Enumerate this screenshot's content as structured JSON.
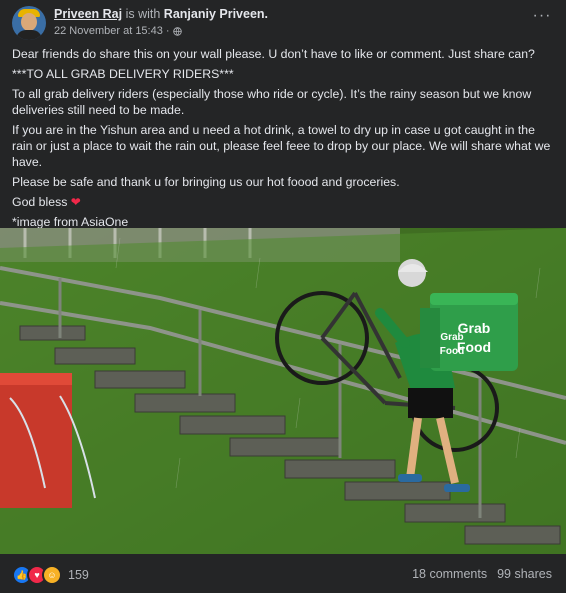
{
  "author": {
    "name": "Priveen Raj",
    "with_text": "is with",
    "tagged": "Ranjaniy Priveen."
  },
  "timestamp": "22 November at 15:43 ·",
  "privacy_icon": "globe-icon",
  "more_icon": "more-options-icon",
  "post_text": {
    "p1": "Dear friends do share this on your wall please. U don’t have to like or comment.  Just share can?",
    "p2": "***TO ALL GRAB DELIVERY RIDERS***",
    "p3": "To all grab delivery riders (especially those who ride or cycle). It’s the rainy season but we know deliveries still need to be made.",
    "p4": "If you are in the Yishun area and u need a hot drink, a towel to dry up in case u got caught in the rain or just a place to wait the rain out, please feel feee to drop by our place.  We will share what we have.",
    "p5": "Please be safe and thank u for bringing us our hot foood and groceries.",
    "p6": "God bless",
    "p6_emoji": "❤",
    "p7": "*image from AsiaOne"
  },
  "photo": {
    "bag_line1": "Grab",
    "bag_line2": "Food",
    "bag_side1": "Grab",
    "bag_side2": "Food",
    "colors": {
      "grass": "#3e6b23",
      "bag": "#2f9e4a",
      "jersey": "#1f8a3e"
    }
  },
  "footer": {
    "reactions": [
      "like-icon",
      "love-icon",
      "care-icon"
    ],
    "reaction_count": "159",
    "comments": "18 comments",
    "shares": "99 shares"
  },
  "colors": {
    "background": "#242526",
    "text": "#e4e6eb",
    "secondary": "#b0b3b8",
    "like": "#1877f2",
    "love": "#f02849",
    "care": "#f7b125"
  }
}
